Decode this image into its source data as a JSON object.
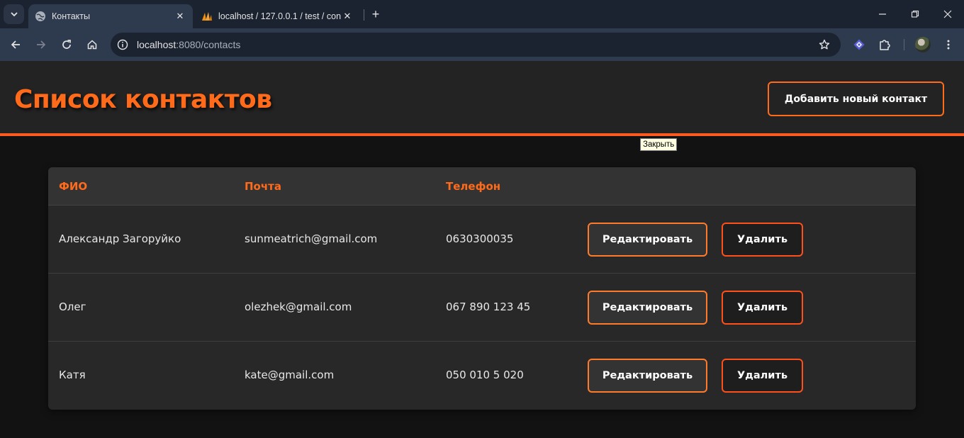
{
  "browser": {
    "tabs": [
      {
        "title": "Контакты",
        "active": true,
        "favicon": "globe-icon"
      },
      {
        "title": "localhost / 127.0.0.1 / test / con",
        "active": false,
        "favicon": "phpmyadmin-icon"
      }
    ],
    "url_host": "localhost",
    "url_rest": ":8080/contacts"
  },
  "header": {
    "title": "Список контактов",
    "add_button_label": "Добавить новый контакт"
  },
  "table": {
    "columns": {
      "name": "ФИО",
      "email": "Почта",
      "phone": "Телефон"
    },
    "rows": [
      {
        "name": "Александр Загоруйко",
        "email": "sunmeatrich@gmail.com",
        "phone": "0630300035",
        "edit_label": "Редактировать",
        "delete_label": "Удалить"
      },
      {
        "name": "Олег",
        "email": "olezhek@gmail.com",
        "phone": "067 890 123 45",
        "edit_label": "Редактировать",
        "delete_label": "Удалить"
      },
      {
        "name": "Катя",
        "email": "kate@gmail.com",
        "phone": "050 010 5 020",
        "edit_label": "Редактировать",
        "delete_label": "Удалить"
      }
    ]
  },
  "tooltip": "Закрыть",
  "colors": {
    "accent": "#ff6b1a",
    "header_border": "#ff5a1f",
    "delete_border": "#ff4f1a"
  }
}
